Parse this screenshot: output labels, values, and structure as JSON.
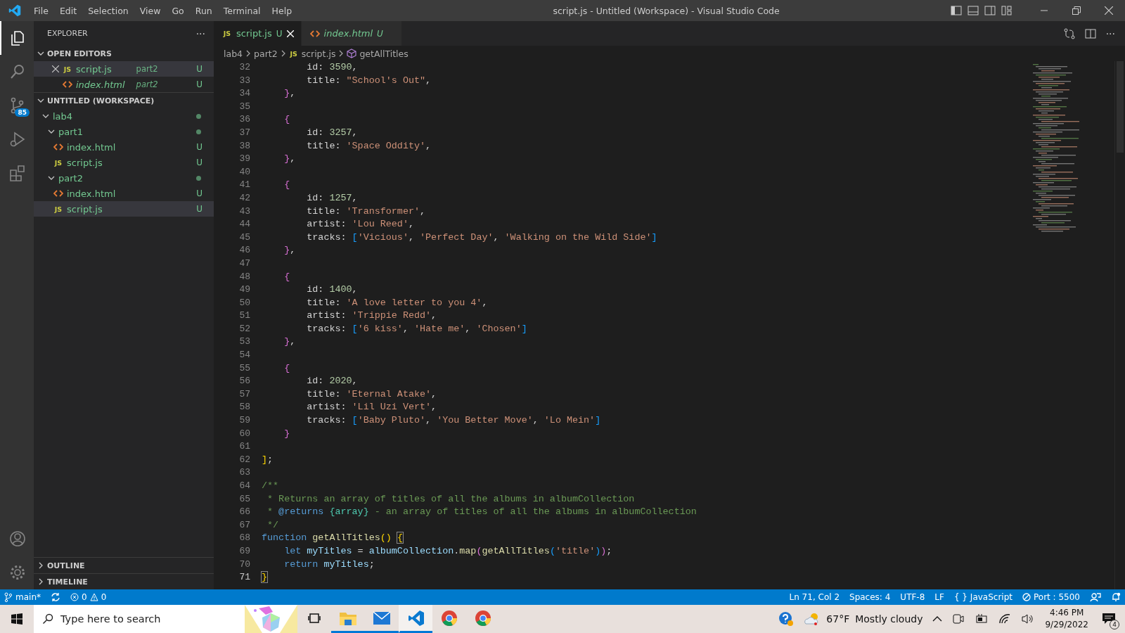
{
  "window": {
    "title": "script.js - Untitled (Workspace) - Visual Studio Code",
    "menu": [
      "File",
      "Edit",
      "Selection",
      "View",
      "Go",
      "Run",
      "Terminal",
      "Help"
    ]
  },
  "activity_bar": {
    "items": [
      {
        "kind": "files",
        "selected": true
      },
      {
        "kind": "search",
        "selected": false
      },
      {
        "kind": "source-control",
        "selected": false,
        "badge": "85"
      },
      {
        "kind": "run",
        "selected": false
      },
      {
        "kind": "extensions",
        "selected": false
      }
    ],
    "bottom": [
      {
        "kind": "account"
      },
      {
        "kind": "settings"
      }
    ]
  },
  "sidebar": {
    "title": "EXPLORER",
    "more": "···",
    "open_editors": {
      "title": "OPEN EDITORS",
      "expanded": true,
      "items": [
        {
          "kind": "js",
          "icon_text": "JS",
          "label": "script.js",
          "folder": "part2",
          "badge": "U",
          "preview": false,
          "selected": true
        },
        {
          "kind": "html",
          "label": "index.html",
          "folder": "part2",
          "badge": "U",
          "preview": true,
          "selected": false
        }
      ]
    },
    "workspace": {
      "title": "UNTITLED (WORKSPACE)",
      "expanded": true,
      "items": [
        {
          "kind": "folder",
          "label": "lab4",
          "expanded": true,
          "dot": true,
          "selected": false,
          "children": [
            {
              "kind": "folder",
              "label": "part1",
              "expanded": true,
              "dot": true,
              "selected": false,
              "children": [
                {
                  "kind": "html",
                  "label": "index.html",
                  "badge": "U",
                  "selected": false
                },
                {
                  "kind": "js",
                  "icon_text": "JS",
                  "label": "script.js",
                  "badge": "U",
                  "selected": false
                }
              ]
            },
            {
              "kind": "folder",
              "label": "part2",
              "expanded": true,
              "dot": true,
              "selected": false,
              "children": [
                {
                  "kind": "html",
                  "label": "index.html",
                  "badge": "U",
                  "selected": false
                },
                {
                  "kind": "js",
                  "icon_text": "JS",
                  "label": "script.js",
                  "badge": "U",
                  "selected": true
                }
              ]
            }
          ]
        }
      ]
    },
    "panels": [
      {
        "title": "OUTLINE",
        "expanded": false
      },
      {
        "title": "TIMELINE",
        "expanded": false
      }
    ]
  },
  "tabs": [
    {
      "kind": "js",
      "icon_text": "JS",
      "label": "script.js",
      "badge": "U",
      "preview": false,
      "selected": true
    },
    {
      "kind": "html",
      "label": "index.html",
      "badge": "U",
      "preview": true,
      "selected": false
    }
  ],
  "breadcrumbs": [
    {
      "kind": "folder",
      "label": "lab4"
    },
    {
      "kind": "folder",
      "label": "part2"
    },
    {
      "kind": "js",
      "icon_text": "JS",
      "label": "script.js"
    },
    {
      "kind": "symbol",
      "label": "getAllTitles"
    }
  ],
  "code": {
    "lines": [
      {
        "number": "32",
        "tokens": [
          {
            "kind": "plain",
            "text": "        id: "
          },
          {
            "kind": "num",
            "text": "3590"
          },
          {
            "kind": "plain",
            "text": ","
          }
        ]
      },
      {
        "number": "33",
        "tokens": [
          {
            "kind": "plain",
            "text": "        title: "
          },
          {
            "kind": "str",
            "text": "\"School's Out\""
          },
          {
            "kind": "plain",
            "text": ","
          }
        ]
      },
      {
        "number": "34",
        "tokens": [
          {
            "kind": "brace",
            "text": "    }"
          },
          {
            "kind": "plain",
            "text": ","
          }
        ]
      },
      {
        "number": "35"
      },
      {
        "number": "36",
        "tokens": [
          {
            "kind": "brace",
            "text": "    {"
          }
        ]
      },
      {
        "number": "37",
        "tokens": [
          {
            "kind": "plain",
            "text": "        id: "
          },
          {
            "kind": "num",
            "text": "3257"
          },
          {
            "kind": "plain",
            "text": ","
          }
        ]
      },
      {
        "number": "38",
        "tokens": [
          {
            "kind": "plain",
            "text": "        title: "
          },
          {
            "kind": "str",
            "text": "'Space Oddity'"
          },
          {
            "kind": "plain",
            "text": ","
          }
        ]
      },
      {
        "number": "39",
        "tokens": [
          {
            "kind": "brace",
            "text": "    }"
          },
          {
            "kind": "plain",
            "text": ","
          }
        ]
      },
      {
        "number": "40"
      },
      {
        "number": "41",
        "tokens": [
          {
            "kind": "brace",
            "text": "    {"
          }
        ]
      },
      {
        "number": "42",
        "tokens": [
          {
            "kind": "plain",
            "text": "        id: "
          },
          {
            "kind": "num",
            "text": "1257"
          },
          {
            "kind": "plain",
            "text": ","
          }
        ]
      },
      {
        "number": "43",
        "tokens": [
          {
            "kind": "plain",
            "text": "        title: "
          },
          {
            "kind": "str",
            "text": "'Transformer'"
          },
          {
            "kind": "plain",
            "text": ","
          }
        ]
      },
      {
        "number": "44",
        "tokens": [
          {
            "kind": "plain",
            "text": "        artist: "
          },
          {
            "kind": "str",
            "text": "'Lou Reed'"
          },
          {
            "kind": "plain",
            "text": ","
          }
        ]
      },
      {
        "number": "45",
        "tokens": [
          {
            "kind": "plain",
            "text": "        tracks: "
          },
          {
            "kind": "bracket",
            "text": "["
          },
          {
            "kind": "str",
            "text": "'Vicious'"
          },
          {
            "kind": "plain",
            "text": ", "
          },
          {
            "kind": "str",
            "text": "'Perfect Day'"
          },
          {
            "kind": "plain",
            "text": ", "
          },
          {
            "kind": "str",
            "text": "'Walking on the Wild Side'"
          },
          {
            "kind": "bracket",
            "text": "]"
          }
        ]
      },
      {
        "number": "46",
        "tokens": [
          {
            "kind": "brace",
            "text": "    }"
          },
          {
            "kind": "plain",
            "text": ","
          }
        ]
      },
      {
        "number": "47"
      },
      {
        "number": "48",
        "tokens": [
          {
            "kind": "brace",
            "text": "    {"
          }
        ]
      },
      {
        "number": "49",
        "tokens": [
          {
            "kind": "plain",
            "text": "        id: "
          },
          {
            "kind": "num",
            "text": "1400"
          },
          {
            "kind": "plain",
            "text": ","
          }
        ]
      },
      {
        "number": "50",
        "tokens": [
          {
            "kind": "plain",
            "text": "        title: "
          },
          {
            "kind": "str",
            "text": "'A love letter to you 4'"
          },
          {
            "kind": "plain",
            "text": ","
          }
        ]
      },
      {
        "number": "51",
        "tokens": [
          {
            "kind": "plain",
            "text": "        artist: "
          },
          {
            "kind": "str",
            "text": "'Trippie Redd'"
          },
          {
            "kind": "plain",
            "text": ","
          }
        ]
      },
      {
        "number": "52",
        "tokens": [
          {
            "kind": "plain",
            "text": "        tracks: "
          },
          {
            "kind": "bracket",
            "text": "["
          },
          {
            "kind": "str",
            "text": "'6 kiss'"
          },
          {
            "kind": "plain",
            "text": ", "
          },
          {
            "kind": "str",
            "text": "'Hate me'"
          },
          {
            "kind": "plain",
            "text": ", "
          },
          {
            "kind": "str",
            "text": "'Chosen'"
          },
          {
            "kind": "bracket",
            "text": "]"
          }
        ]
      },
      {
        "number": "53",
        "tokens": [
          {
            "kind": "brace",
            "text": "    }"
          },
          {
            "kind": "plain",
            "text": ","
          }
        ]
      },
      {
        "number": "54"
      },
      {
        "number": "55",
        "tokens": [
          {
            "kind": "brace",
            "text": "    {"
          }
        ]
      },
      {
        "number": "56",
        "tokens": [
          {
            "kind": "plain",
            "text": "        id: "
          },
          {
            "kind": "num",
            "text": "2020"
          },
          {
            "kind": "plain",
            "text": ","
          }
        ]
      },
      {
        "number": "57",
        "tokens": [
          {
            "kind": "plain",
            "text": "        title: "
          },
          {
            "kind": "str",
            "text": "'Eternal Atake'"
          },
          {
            "kind": "plain",
            "text": ","
          }
        ]
      },
      {
        "number": "58",
        "tokens": [
          {
            "kind": "plain",
            "text": "        artist: "
          },
          {
            "kind": "str",
            "text": "'Lil Uzi Vert'"
          },
          {
            "kind": "plain",
            "text": ","
          }
        ]
      },
      {
        "number": "59",
        "tokens": [
          {
            "kind": "plain",
            "text": "        tracks: "
          },
          {
            "kind": "bracket",
            "text": "["
          },
          {
            "kind": "str",
            "text": "'Baby Pluto'"
          },
          {
            "kind": "plain",
            "text": ", "
          },
          {
            "kind": "str",
            "text": "'You Better Move'"
          },
          {
            "kind": "plain",
            "text": ", "
          },
          {
            "kind": "str",
            "text": "'Lo Mein'"
          },
          {
            "kind": "bracket",
            "text": "]"
          }
        ]
      },
      {
        "number": "60",
        "tokens": [
          {
            "kind": "brace",
            "text": "    }"
          }
        ]
      },
      {
        "number": "61"
      },
      {
        "number": "62",
        "tokens": [
          {
            "kind": "paren",
            "text": "]"
          },
          {
            "kind": "plain",
            "text": ";"
          }
        ]
      },
      {
        "number": "63"
      },
      {
        "number": "64",
        "tokens": [
          {
            "kind": "comment",
            "text": "/**"
          }
        ]
      },
      {
        "number": "65",
        "tokens": [
          {
            "kind": "comment",
            "text": " * Returns an array of titles of all the albums in albumCollection"
          }
        ]
      },
      {
        "number": "66",
        "tokens": [
          {
            "kind": "comment",
            "text": " * "
          },
          {
            "kind": "tag",
            "text": "@returns"
          },
          {
            "kind": "type",
            "text": " {array}"
          },
          {
            "kind": "comment",
            "text": " - an array of titles of all the albums in albumCollection"
          }
        ]
      },
      {
        "number": "67",
        "tokens": [
          {
            "kind": "comment",
            "text": " */"
          }
        ]
      },
      {
        "number": "68",
        "tokens": [
          {
            "kind": "keyword",
            "text": "function"
          },
          {
            "kind": "fn",
            "text": " getAllTitles"
          },
          {
            "kind": "paren",
            "text": "() "
          },
          {
            "kind": "match",
            "text": "{"
          }
        ]
      },
      {
        "number": "69",
        "tokens": [
          {
            "kind": "keyword",
            "text": "    let"
          },
          {
            "kind": "var",
            "text": " myTitles"
          },
          {
            "kind": "plain",
            "text": " = "
          },
          {
            "kind": "var",
            "text": "albumCollection"
          },
          {
            "kind": "plain",
            "text": "."
          },
          {
            "kind": "fn",
            "text": "map"
          },
          {
            "kind": "brace",
            "text": "("
          },
          {
            "kind": "fn",
            "text": "getAllTitles"
          },
          {
            "kind": "bracket",
            "text": "("
          },
          {
            "kind": "str",
            "text": "'title'"
          },
          {
            "kind": "bracket",
            "text": ")"
          },
          {
            "kind": "brace",
            "text": ")"
          },
          {
            "kind": "plain",
            "text": ";"
          }
        ]
      },
      {
        "number": "70",
        "tokens": [
          {
            "kind": "keyword",
            "text": "    return"
          },
          {
            "kind": "var",
            "text": " myTitles"
          },
          {
            "kind": "plain",
            "text": ";"
          }
        ]
      },
      {
        "number": "71",
        "tokens": [
          {
            "kind": "match",
            "text": "}"
          }
        ]
      }
    ]
  },
  "status_bar": {
    "branch": "main*",
    "errors": "0",
    "warnings": "0",
    "right": [
      {
        "kind": "text",
        "label": "Ln 71, Col 2"
      },
      {
        "kind": "text",
        "label": "Spaces: 4"
      },
      {
        "kind": "text",
        "label": "UTF-8"
      },
      {
        "kind": "text",
        "label": "LF"
      },
      {
        "kind": "language",
        "icon_text": "{ }",
        "label": "JavaScript"
      },
      {
        "kind": "port",
        "label": "Port : 5500"
      },
      {
        "kind": "feedback"
      },
      {
        "kind": "bell"
      }
    ]
  },
  "taskbar": {
    "search": {
      "placeholder": "Type here to search"
    },
    "apps": [
      {
        "kind": "task-view",
        "running": false,
        "active": false
      },
      {
        "kind": "folder",
        "running": true,
        "active": false
      },
      {
        "kind": "mail",
        "running": true,
        "active": false
      },
      {
        "kind": "vscode",
        "running": true,
        "active": true
      },
      {
        "kind": "chrome",
        "running": false,
        "active": false
      },
      {
        "kind": "chrome",
        "running": false,
        "active": false
      }
    ],
    "weather": {
      "temperature": "67°F",
      "condition": "Mostly cloudy"
    },
    "time": "4:46 PM",
    "date": "9/29/2022",
    "notifications": "4"
  }
}
